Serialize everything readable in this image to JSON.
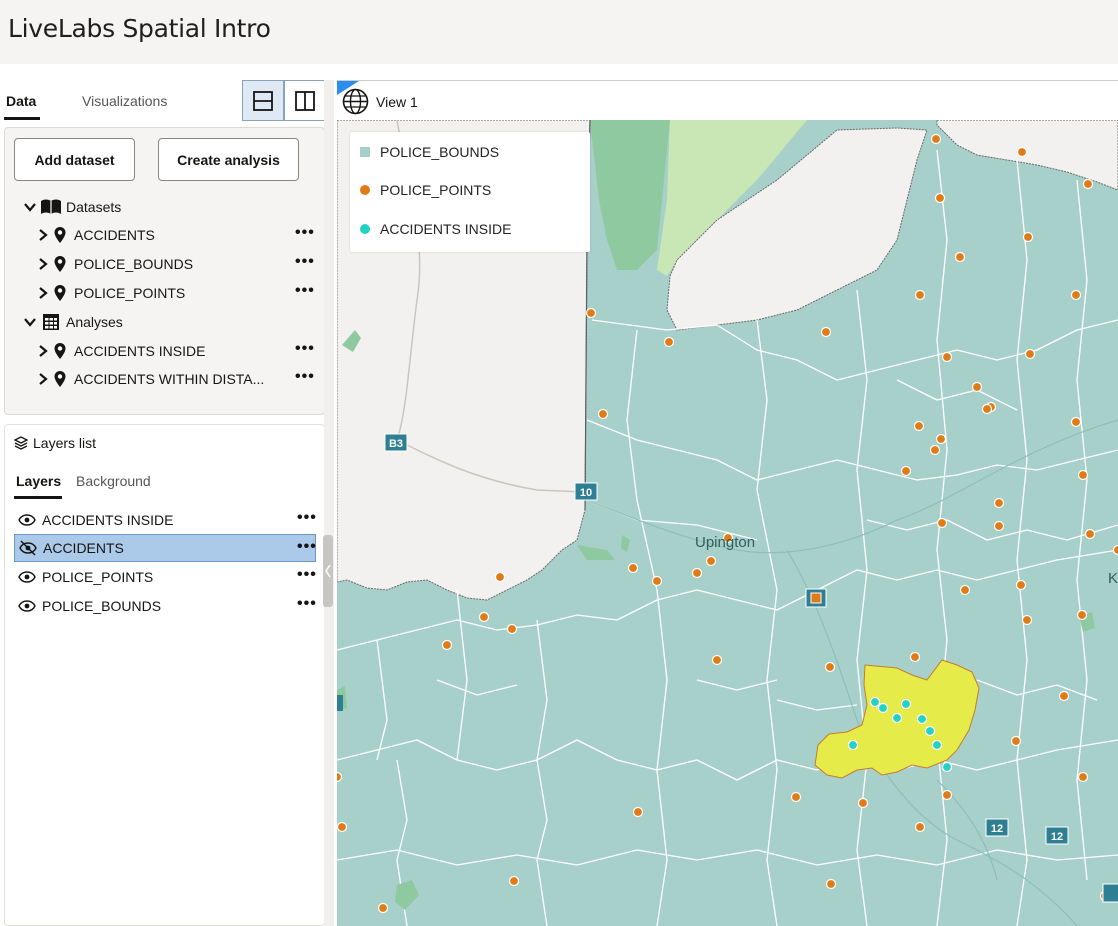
{
  "app": {
    "title": "LiveLabs Spatial Intro"
  },
  "left_tabs": [
    {
      "label": "Data"
    },
    {
      "label": "Visualizations"
    }
  ],
  "buttons": {
    "add_dataset": "Add dataset",
    "create_analysis": "Create analysis"
  },
  "datasets": {
    "group_label": "Datasets",
    "items": [
      {
        "label": "ACCIDENTS"
      },
      {
        "label": "POLICE_BOUNDS"
      },
      {
        "label": "POLICE_POINTS"
      }
    ]
  },
  "analyses": {
    "group_label": "Analyses",
    "items": [
      {
        "label": "ACCIDENTS INSIDE"
      },
      {
        "label": "ACCIDENTS WITHIN DISTA..."
      }
    ]
  },
  "more_glyph": "•••",
  "layers_panel": {
    "title": "Layers list",
    "tabs": [
      {
        "label": "Layers"
      },
      {
        "label": "Background"
      }
    ],
    "layers": [
      {
        "label": "ACCIDENTS INSIDE",
        "visible": true
      },
      {
        "label": "ACCIDENTS",
        "visible": false,
        "selected": true
      },
      {
        "label": "POLICE_POINTS",
        "visible": true
      },
      {
        "label": "POLICE_BOUNDS",
        "visible": true
      }
    ]
  },
  "view": {
    "title": "View 1"
  },
  "legend": {
    "items": [
      {
        "label": "POLICE_BOUNDS",
        "symbol": "square",
        "color": "#a8d0cb"
      },
      {
        "label": "POLICE_POINTS",
        "symbol": "circle",
        "color": "#e07b16"
      },
      {
        "label": "ACCIDENTS INSIDE",
        "symbol": "circle",
        "color": "#22d3c5"
      }
    ]
  },
  "map": {
    "place_labels": [
      "Upington",
      "K"
    ],
    "road_labels": [
      "B3",
      "10",
      "12",
      "12"
    ],
    "highlight_color": "#e5ec4a"
  }
}
